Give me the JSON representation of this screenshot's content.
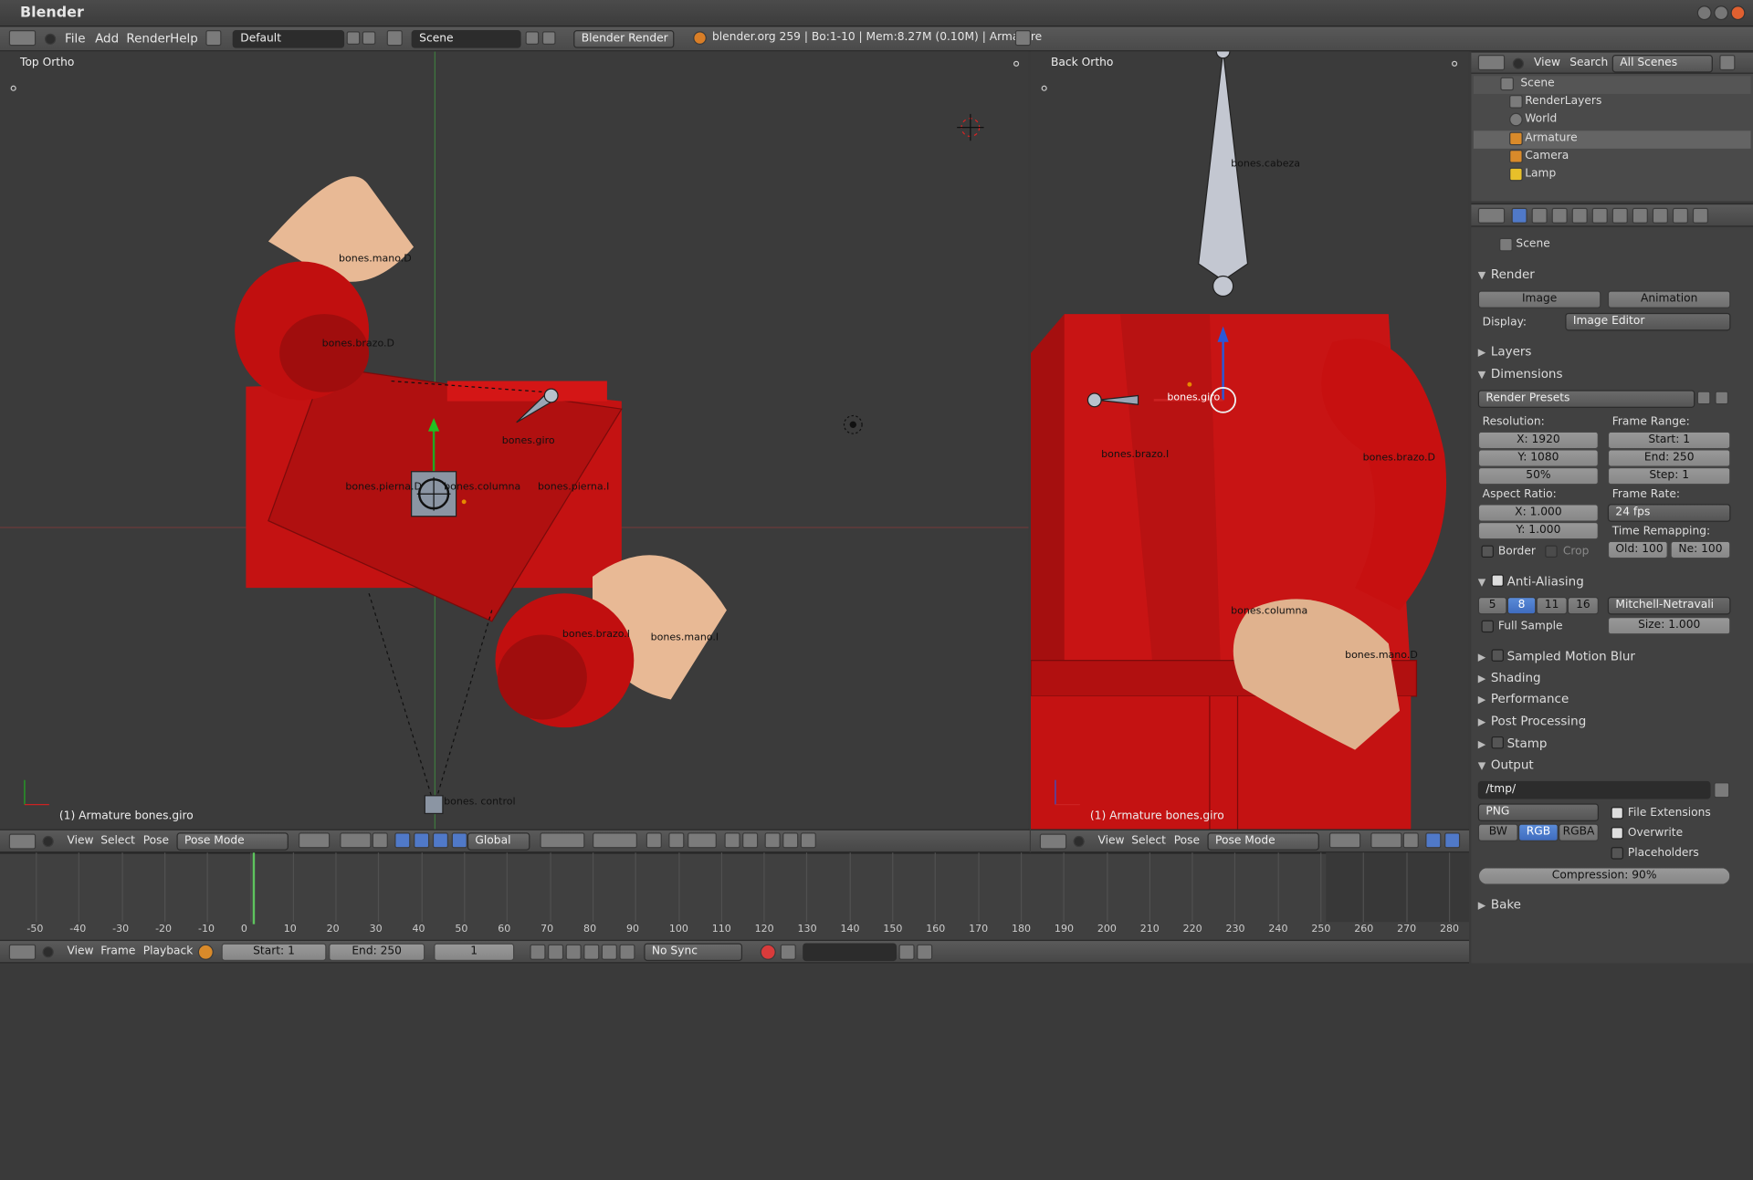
{
  "window": {
    "title": "Blender"
  },
  "topbar": {
    "menu": [
      "File",
      "Add",
      "Render",
      "Help"
    ],
    "layout": "Default",
    "scene": "Scene",
    "engine": "Blender Render",
    "info": "blender.org 259 | Bo:1-10  | Mem:8.27M (0.10M) | Armature"
  },
  "viewport_left": {
    "label": "Top Ortho",
    "status": "(1) Armature bones.giro",
    "bones": [
      "bones.mano.D",
      "bones.brazo.D",
      "bones.giro",
      "bones.pierna.D",
      "bones.columna",
      "bones.pierna.I",
      "bones.brazo.I",
      "bones.mano.I",
      "bones. control"
    ],
    "header": {
      "menus": [
        "View",
        "Select",
        "Pose"
      ],
      "mode": "Pose Mode",
      "orientation": "Global"
    }
  },
  "viewport_right": {
    "label": "Back Ortho",
    "status": "(1) Armature bones.giro",
    "bones": [
      "bones.cabeza",
      "bones.giro",
      "bones.brazo.I",
      "bones.brazo.D",
      "bones.columna",
      "bones.mano.D"
    ],
    "header": {
      "menus": [
        "View",
        "Select",
        "Pose"
      ],
      "mode": "Pose Mode"
    }
  },
  "outliner": {
    "menus": [
      "View",
      "Search"
    ],
    "filter": "All Scenes",
    "items": [
      "Scene",
      "RenderLayers",
      "World",
      "Armature",
      "Camera",
      "Lamp"
    ]
  },
  "properties": {
    "scene_label": "Scene",
    "render": {
      "title": "Render",
      "image_btn": "Image",
      "animation_btn": "Animation",
      "display_label": "Display:",
      "display_value": "Image Editor"
    },
    "layers": "Layers",
    "dimensions": {
      "title": "Dimensions",
      "presets": "Render Presets",
      "resolution_label": "Resolution:",
      "res_x": "X: 1920",
      "res_y": "Y: 1080",
      "res_pct": "50%",
      "frame_range_label": "Frame Range:",
      "start": "Start: 1",
      "end": "End: 250",
      "step": "Step: 1",
      "aspect_label": "Aspect Ratio:",
      "asp_x": "X: 1.000",
      "asp_y": "Y: 1.000",
      "frame_rate_label": "Frame Rate:",
      "fps": "24 fps",
      "time_remap": "Time Remapping:",
      "old": "Old: 100",
      "new": "Ne: 100",
      "border": "Border",
      "crop": "Crop"
    },
    "anti_aliasing": {
      "title": "Anti-Aliasing",
      "samples": [
        "5",
        "8",
        "11",
        "16"
      ],
      "filter": "Mitchell-Netravali",
      "full_sample": "Full Sample",
      "size": "Size: 1.000"
    },
    "sampled_motion_blur": "Sampled Motion Blur",
    "shading": "Shading",
    "performance": "Performance",
    "post_processing": "Post Processing",
    "stamp": "Stamp",
    "output": {
      "title": "Output",
      "path": "/tmp/",
      "format": "PNG",
      "bw": "BW",
      "rgb": "RGB",
      "rgba": "RGBA",
      "file_ext": "File Extensions",
      "overwrite": "Overwrite",
      "placeholders": "Placeholders",
      "compression": "Compression: 90%"
    },
    "bake": "Bake"
  },
  "timeline": {
    "ticks": [
      "-50",
      "-40",
      "-30",
      "-20",
      "-10",
      "0",
      "10",
      "20",
      "30",
      "40",
      "50",
      "60",
      "70",
      "80",
      "90",
      "100",
      "110",
      "120",
      "130",
      "140",
      "150",
      "160",
      "170",
      "180",
      "190",
      "200",
      "210",
      "220",
      "230",
      "240",
      "250",
      "260",
      "270",
      "280"
    ],
    "menus": [
      "View",
      "Frame",
      "Playback"
    ],
    "start": "Start: 1",
    "end": "End: 250",
    "current": "1",
    "sync": "No Sync"
  }
}
